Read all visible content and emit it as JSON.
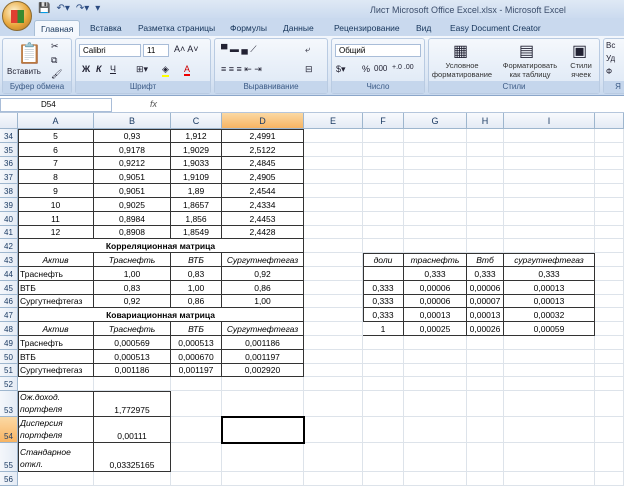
{
  "window": {
    "title": "Лист Microsoft Office Excel.xlsx - Microsoft Excel"
  },
  "tabs": [
    "Главная",
    "Вставка",
    "Разметка страницы",
    "Формулы",
    "Данные",
    "Рецензирование",
    "Вид",
    "Easy Document Creator"
  ],
  "ribbon": {
    "clipboard": {
      "label": "Буфер обмена",
      "paste": "Вставить"
    },
    "font": {
      "label": "Шрифт",
      "name": "Calibri",
      "size": "11",
      "bold": "Ж",
      "italic": "К",
      "underline": "Ч"
    },
    "alignment": {
      "label": "Выравнивание"
    },
    "number": {
      "label": "Число",
      "format": "Общий",
      "percent": "%",
      "thousands": "000"
    },
    "styles": {
      "label": "Стили",
      "conditional": "Условное форматирование",
      "as_table": "Форматировать как таблицу",
      "cell_styles": "Стили ячеек"
    },
    "cells": {
      "insert": "Вс",
      "delete": "Уд",
      "format": "Ф",
      "label": "Я"
    }
  },
  "formula_bar": {
    "name_box": "D54",
    "fx": "fx",
    "value": ""
  },
  "columns": [
    "A",
    "B",
    "C",
    "D",
    "E",
    "F",
    "G",
    "H",
    "I"
  ],
  "selected_cell": "D54",
  "rows": {
    "data": [
      {
        "row": "34",
        "a": "5",
        "b": "0,93",
        "c": "1,912",
        "d": "2,4991"
      },
      {
        "row": "35",
        "a": "6",
        "b": "0,9178",
        "c": "1,9029",
        "d": "2,5122"
      },
      {
        "row": "36",
        "a": "7",
        "b": "0,9212",
        "c": "1,9033",
        "d": "2,4845"
      },
      {
        "row": "37",
        "a": "8",
        "b": "0,9051",
        "c": "1,9109",
        "d": "2,4905"
      },
      {
        "row": "38",
        "a": "9",
        "b": "0,9051",
        "c": "1,89",
        "d": "2,4544"
      },
      {
        "row": "39",
        "a": "10",
        "b": "0,9025",
        "c": "1,8657",
        "d": "2,4334"
      },
      {
        "row": "40",
        "a": "11",
        "b": "0,8984",
        "c": "1,856",
        "d": "2,4453"
      },
      {
        "row": "41",
        "a": "12",
        "b": "0,8908",
        "c": "1,8549",
        "d": "2,4428"
      }
    ],
    "corr_title": "Корреляционная матрица",
    "corr_header": [
      "Актив",
      "Траснефть",
      "ВТБ",
      "Сургутнефтегаз"
    ],
    "corr": [
      [
        "Траснефть",
        "1,00",
        "0,83",
        "0,92"
      ],
      [
        "ВТБ",
        "0,83",
        "1,00",
        "0,86"
      ],
      [
        "Сургутнефтегаз",
        "0,92",
        "0,86",
        "1,00"
      ]
    ],
    "cov_title": "Ковариационная матрица",
    "cov_header": [
      "Актив",
      "Траснефть",
      "ВТБ",
      "Сургутнефтегаз"
    ],
    "cov": [
      [
        "Траснефть",
        "0,000569",
        "0,000513",
        "0,001186"
      ],
      [
        "ВТБ",
        "0,000513",
        "0,000670",
        "0,001197"
      ],
      [
        "Сургутнефтегаз",
        "0,001186",
        "0,001197",
        "0,002920"
      ]
    ],
    "summary": [
      {
        "label": "Ож.доход. портфеля",
        "value": "1,772975"
      },
      {
        "label": "Дисперсия портфеля",
        "value": "0,00111"
      },
      {
        "label": "Стандарное откл.",
        "value": "0,03325165"
      }
    ]
  },
  "weights_table": {
    "header": [
      "доли",
      "траснефть",
      "Втб",
      "сургутнефтегаз"
    ],
    "rows": [
      [
        "",
        "0,333",
        "0,333",
        "0,333"
      ],
      [
        "0,333",
        "0,00006",
        "0,00006",
        "0,00013"
      ],
      [
        "0,333",
        "0,00006",
        "0,00007",
        "0,00013"
      ],
      [
        "0,333",
        "0,00013",
        "0,00013",
        "0,00032"
      ],
      [
        "1",
        "0,00025",
        "0,00026",
        "0,00059"
      ]
    ]
  },
  "row_numbers": [
    "34",
    "35",
    "36",
    "37",
    "38",
    "39",
    "40",
    "41",
    "42",
    "43",
    "44",
    "45",
    "46",
    "47",
    "48",
    "49",
    "50",
    "51",
    "52",
    "53",
    "54",
    "55",
    "56"
  ]
}
